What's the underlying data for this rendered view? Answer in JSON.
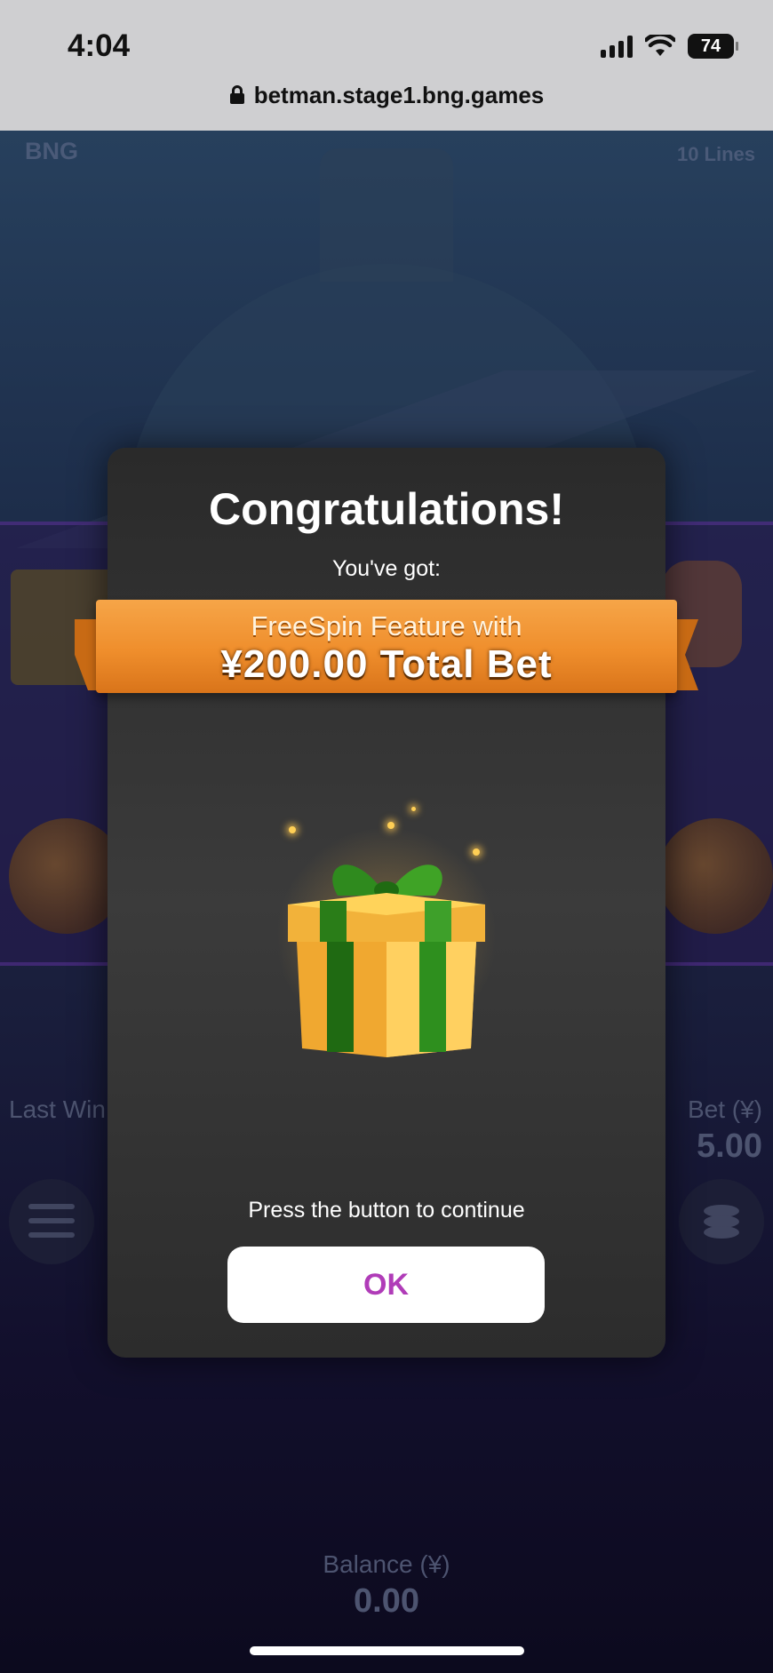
{
  "status_bar": {
    "time": "4:04",
    "battery": "74",
    "url": "betman.stage1.bng.games"
  },
  "game": {
    "brand": "BNG",
    "lines": "10 Lines",
    "last_win_label": "Last Win",
    "bet_label": "Bet (¥)",
    "bet_value": "5.00",
    "balance_label": "Balance (¥)",
    "balance_value": "0.00"
  },
  "dialog": {
    "title": "Congratulations!",
    "subtitle": "You've got:",
    "ribbon_line1": "FreeSpin Feature with",
    "ribbon_line2": "¥200.00 Total Bet",
    "continue_text": "Press the button to continue",
    "ok_label": "OK"
  },
  "colors": {
    "accent_orange": "#ef8e2c",
    "ok_text": "#b03cb8",
    "dialog_bg": "#333333"
  }
}
